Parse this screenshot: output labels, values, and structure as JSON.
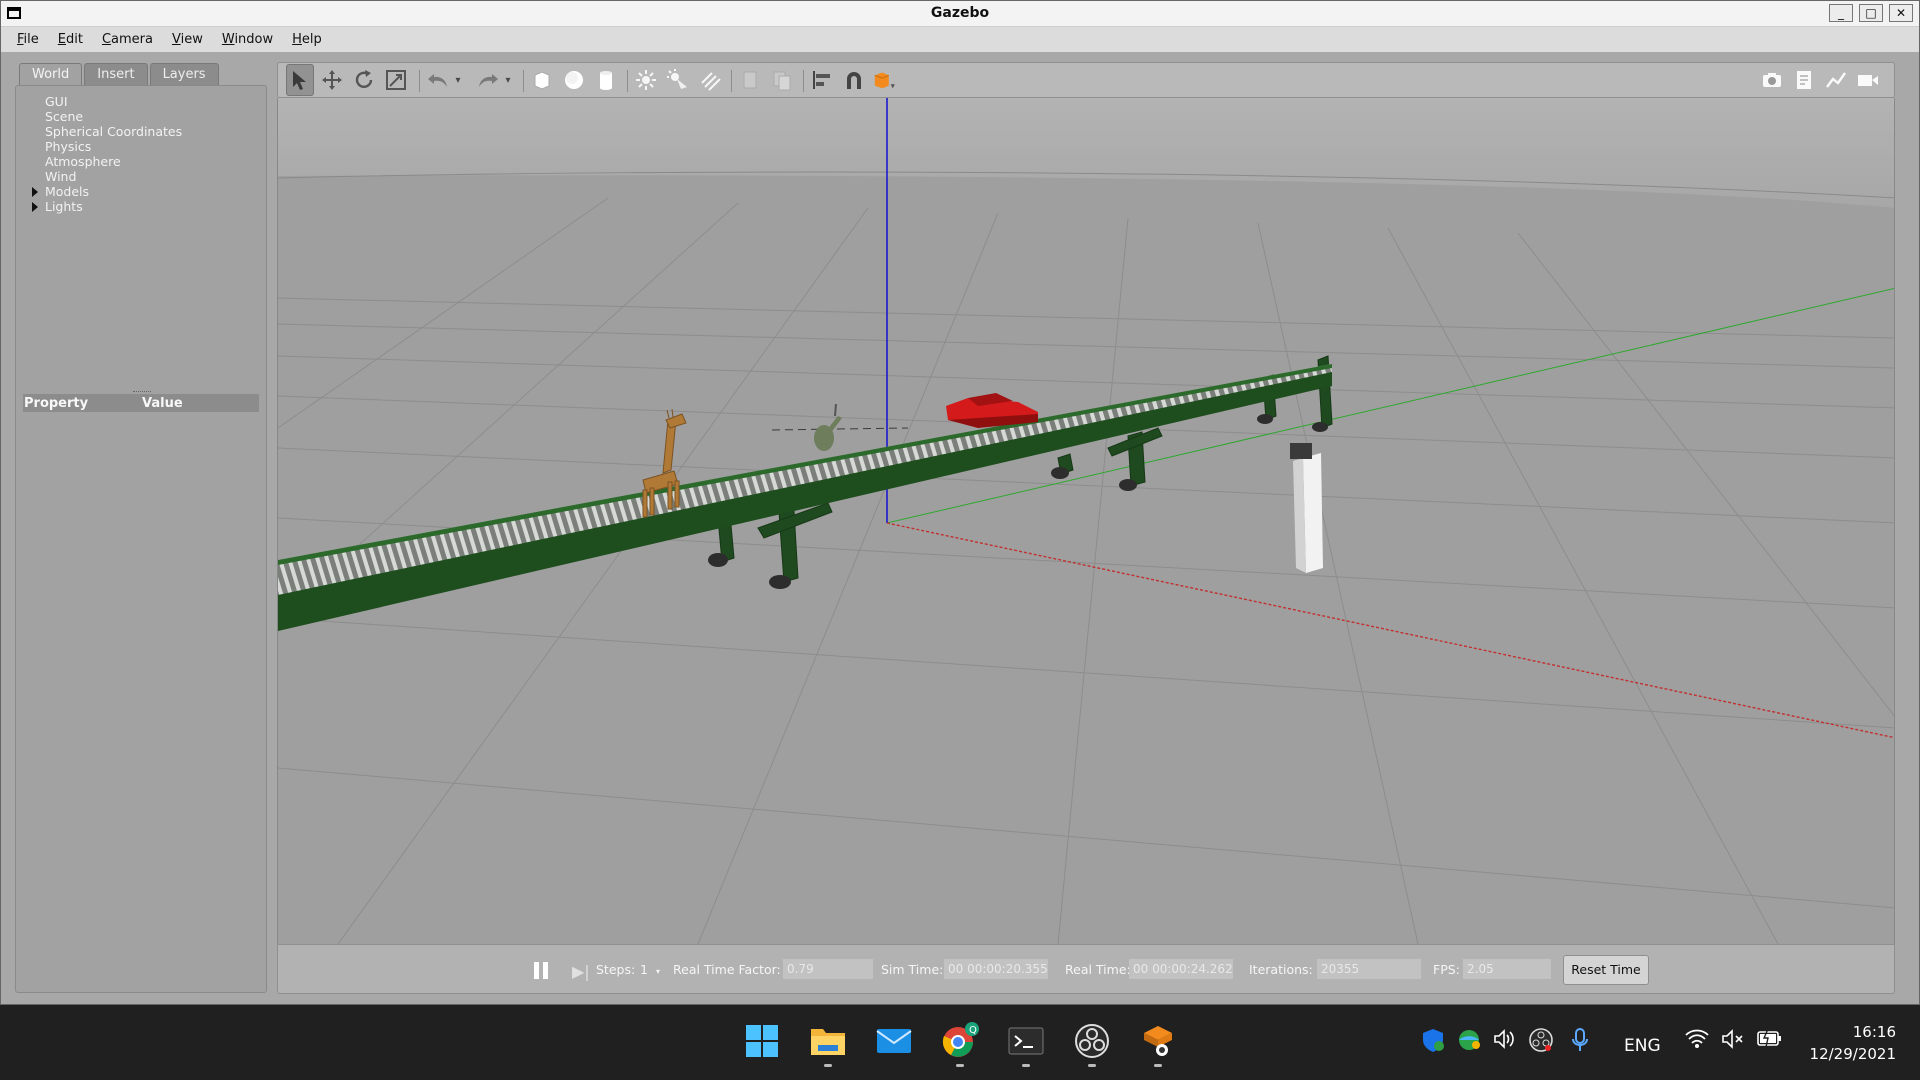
{
  "window": {
    "title": "Gazebo",
    "minimize": "_",
    "maximize": "□",
    "close": "✕"
  },
  "menu": [
    "File",
    "Edit",
    "Camera",
    "View",
    "Window",
    "Help"
  ],
  "left_panel": {
    "tabs": [
      "World",
      "Insert",
      "Layers"
    ],
    "active_tab": "World",
    "tree": [
      "GUI",
      "Scene",
      "Spherical Coordinates",
      "Physics",
      "Atmosphere",
      "Wind",
      "Models",
      "Lights"
    ],
    "property_header": {
      "property": "Property",
      "value": "Value"
    }
  },
  "toolbar": {
    "tools": [
      "select-arrow",
      "translate",
      "rotate",
      "scale",
      "undo",
      "redo",
      "box",
      "sphere",
      "cylinder",
      "point-light",
      "spot-light",
      "directional-light",
      "copy",
      "paste",
      "align",
      "snap",
      "change-view"
    ],
    "right_tools": [
      "screenshot",
      "log",
      "plot",
      "record-video"
    ]
  },
  "scene": {
    "models": [
      "giraffe",
      "helicopter",
      "red car",
      "conveyor belt",
      "pillar"
    ],
    "colors": {
      "conveyor": "#1e4d1e",
      "car": "#d41a1a",
      "giraffe": "#b07a36",
      "x_axis": "#c23030",
      "y_axis": "#2ea82e",
      "z_axis": "#1a1ad0"
    }
  },
  "bottom_bar": {
    "steps_label": "Steps:",
    "steps_value": "1",
    "rtf_label": "Real Time Factor:",
    "rtf_value": "0.79",
    "sim_time_label": "Sim Time:",
    "sim_time_value": "00 00:00:20.355",
    "real_time_label": "Real Time:",
    "real_time_value": "00 00:00:24.262",
    "iterations_label": "Iterations:",
    "iterations_value": "20355",
    "fps_label": "FPS:",
    "fps_value": "2.05",
    "reset_label": "Reset Time"
  },
  "taskbar": {
    "apps": [
      "start",
      "file-explorer",
      "mail",
      "chrome",
      "terminal",
      "obs",
      "ubuntu-app"
    ],
    "language": "ENG",
    "time": "16:16",
    "date": "12/29/2021",
    "chrome_badge": "Q"
  }
}
